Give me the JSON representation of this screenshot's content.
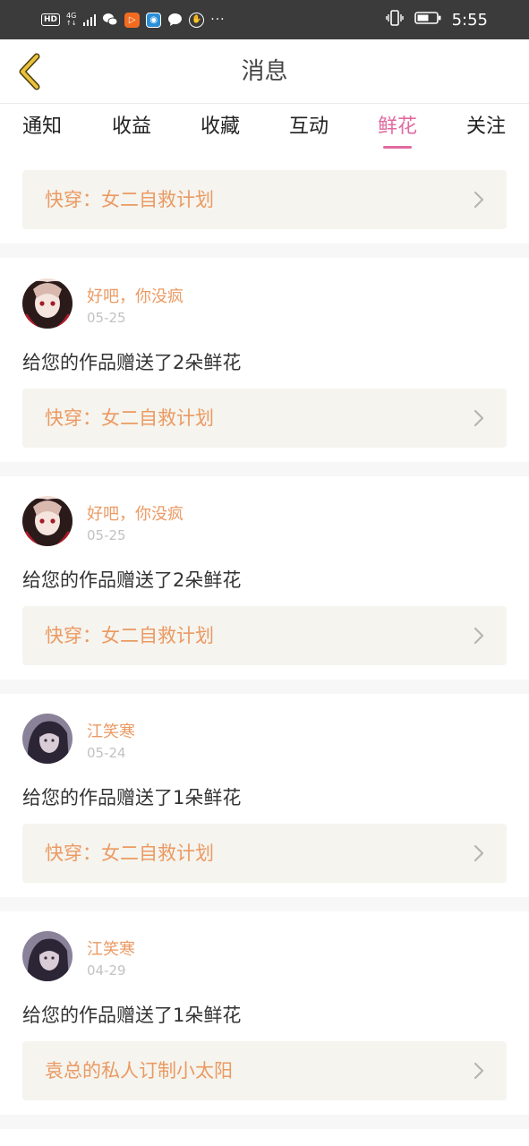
{
  "status_bar": {
    "hd": "HD",
    "network": "4G",
    "time": "5:55",
    "more": "···"
  },
  "header": {
    "title": "消息"
  },
  "tabs": [
    {
      "label": "通知",
      "active": false
    },
    {
      "label": "收益",
      "active": false
    },
    {
      "label": "收藏",
      "active": false
    },
    {
      "label": "互动",
      "active": false
    },
    {
      "label": "鲜花",
      "active": true
    },
    {
      "label": "关注",
      "active": false
    }
  ],
  "top_book": {
    "title": "快穿：女二自救计划"
  },
  "messages": [
    {
      "username": "好吧，你没疯",
      "date": "05-25",
      "text": "给您的作品赠送了2朵鲜花",
      "book": "快穿：女二自救计划"
    },
    {
      "username": "好吧，你没疯",
      "date": "05-25",
      "text": "给您的作品赠送了2朵鲜花",
      "book": "快穿：女二自救计划"
    },
    {
      "username": "江笑寒",
      "date": "05-24",
      "text": "给您的作品赠送了1朵鲜花",
      "book": "快穿：女二自救计划"
    },
    {
      "username": "江笑寒",
      "date": "04-29",
      "text": "给您的作品赠送了1朵鲜花",
      "book": "袁总的私人订制小太阳"
    }
  ],
  "colors": {
    "accent_tab": "#e06aa0",
    "book_text": "#eb9a63",
    "back_arrow": "#e8c23a",
    "book_bg": "#f5f4ee"
  }
}
